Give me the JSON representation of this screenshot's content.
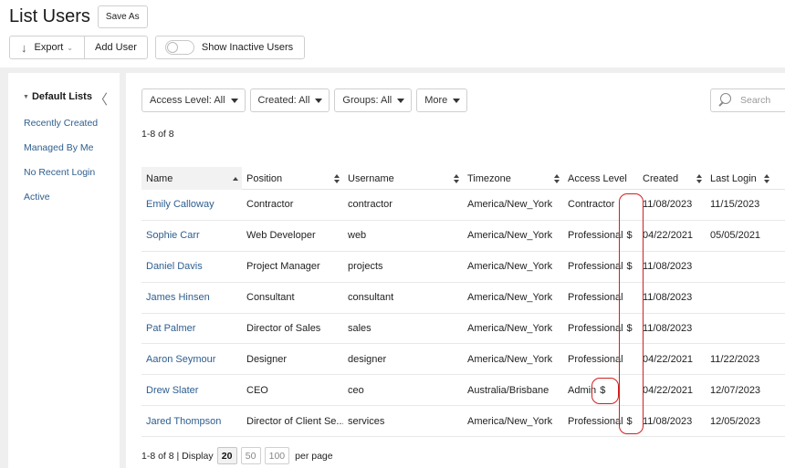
{
  "header": {
    "title": "List Users",
    "save_as_label": "Save As"
  },
  "toolbar": {
    "export_label": "Export",
    "add_user_label": "Add User",
    "show_inactive_label": "Show Inactive Users",
    "show_inactive_on": false
  },
  "sidebar": {
    "title": "Default Lists",
    "items": [
      {
        "label": "Recently Created"
      },
      {
        "label": "Managed By Me"
      },
      {
        "label": "No Recent Login"
      },
      {
        "label": "Active"
      }
    ]
  },
  "filters": [
    {
      "label": "Access Level: All"
    },
    {
      "label": "Created: All"
    },
    {
      "label": "Groups: All"
    },
    {
      "label": "More"
    }
  ],
  "search": {
    "placeholder": "Search"
  },
  "result_count": "1-8 of 8",
  "table": {
    "columns": [
      "Name",
      "Position",
      "Username",
      "Timezone",
      "Access Level",
      "Created",
      "Last Login"
    ],
    "sorted_column": "Name",
    "rows": [
      {
        "name": "Emily Calloway",
        "position": "Contractor",
        "username": "contractor",
        "timezone": "America/New_York",
        "access": "Contractor",
        "dollar": "",
        "created": "11/08/2023",
        "last_login": "11/15/2023"
      },
      {
        "name": "Sophie Carr",
        "position": "Web Developer",
        "username": "web",
        "timezone": "America/New_York",
        "access": "Professional",
        "dollar": "$",
        "created": "04/22/2021",
        "last_login": "05/05/2021"
      },
      {
        "name": "Daniel Davis",
        "position": "Project Manager",
        "username": "projects",
        "timezone": "America/New_York",
        "access": "Professional",
        "dollar": "$",
        "created": "11/08/2023",
        "last_login": ""
      },
      {
        "name": "James Hinsen",
        "position": "Consultant",
        "username": "consultant",
        "timezone": "America/New_York",
        "access": "Professional",
        "dollar": "",
        "created": "11/08/2023",
        "last_login": ""
      },
      {
        "name": "Pat Palmer",
        "position": "Director of Sales",
        "username": "sales",
        "timezone": "America/New_York",
        "access": "Professional",
        "dollar": "$",
        "created": "11/08/2023",
        "last_login": ""
      },
      {
        "name": "Aaron Seymour",
        "position": "Designer",
        "username": "designer",
        "timezone": "America/New_York",
        "access": "Professional",
        "dollar": "",
        "created": "04/22/2021",
        "last_login": "11/22/2023"
      },
      {
        "name": "Drew Slater",
        "position": "CEO",
        "username": "ceo",
        "timezone": "Australia/Brisbane",
        "access": "Admin",
        "dollar": "$",
        "created": "04/22/2021",
        "last_login": "12/07/2023"
      },
      {
        "name": "Jared Thompson",
        "position": "Director of Client Se...",
        "username": "services",
        "timezone": "America/New_York",
        "access": "Professional",
        "dollar": "$",
        "created": "11/08/2023",
        "last_login": "12/05/2023"
      }
    ]
  },
  "pager": {
    "summary": "1-8 of 8 | Display",
    "sizes": [
      "20",
      "50",
      "100"
    ],
    "active_size": "20",
    "suffix": "per page"
  },
  "colors": {
    "link": "#2e5e8f",
    "annotation": "#d31f1f",
    "panel_bg": "#efefef"
  }
}
